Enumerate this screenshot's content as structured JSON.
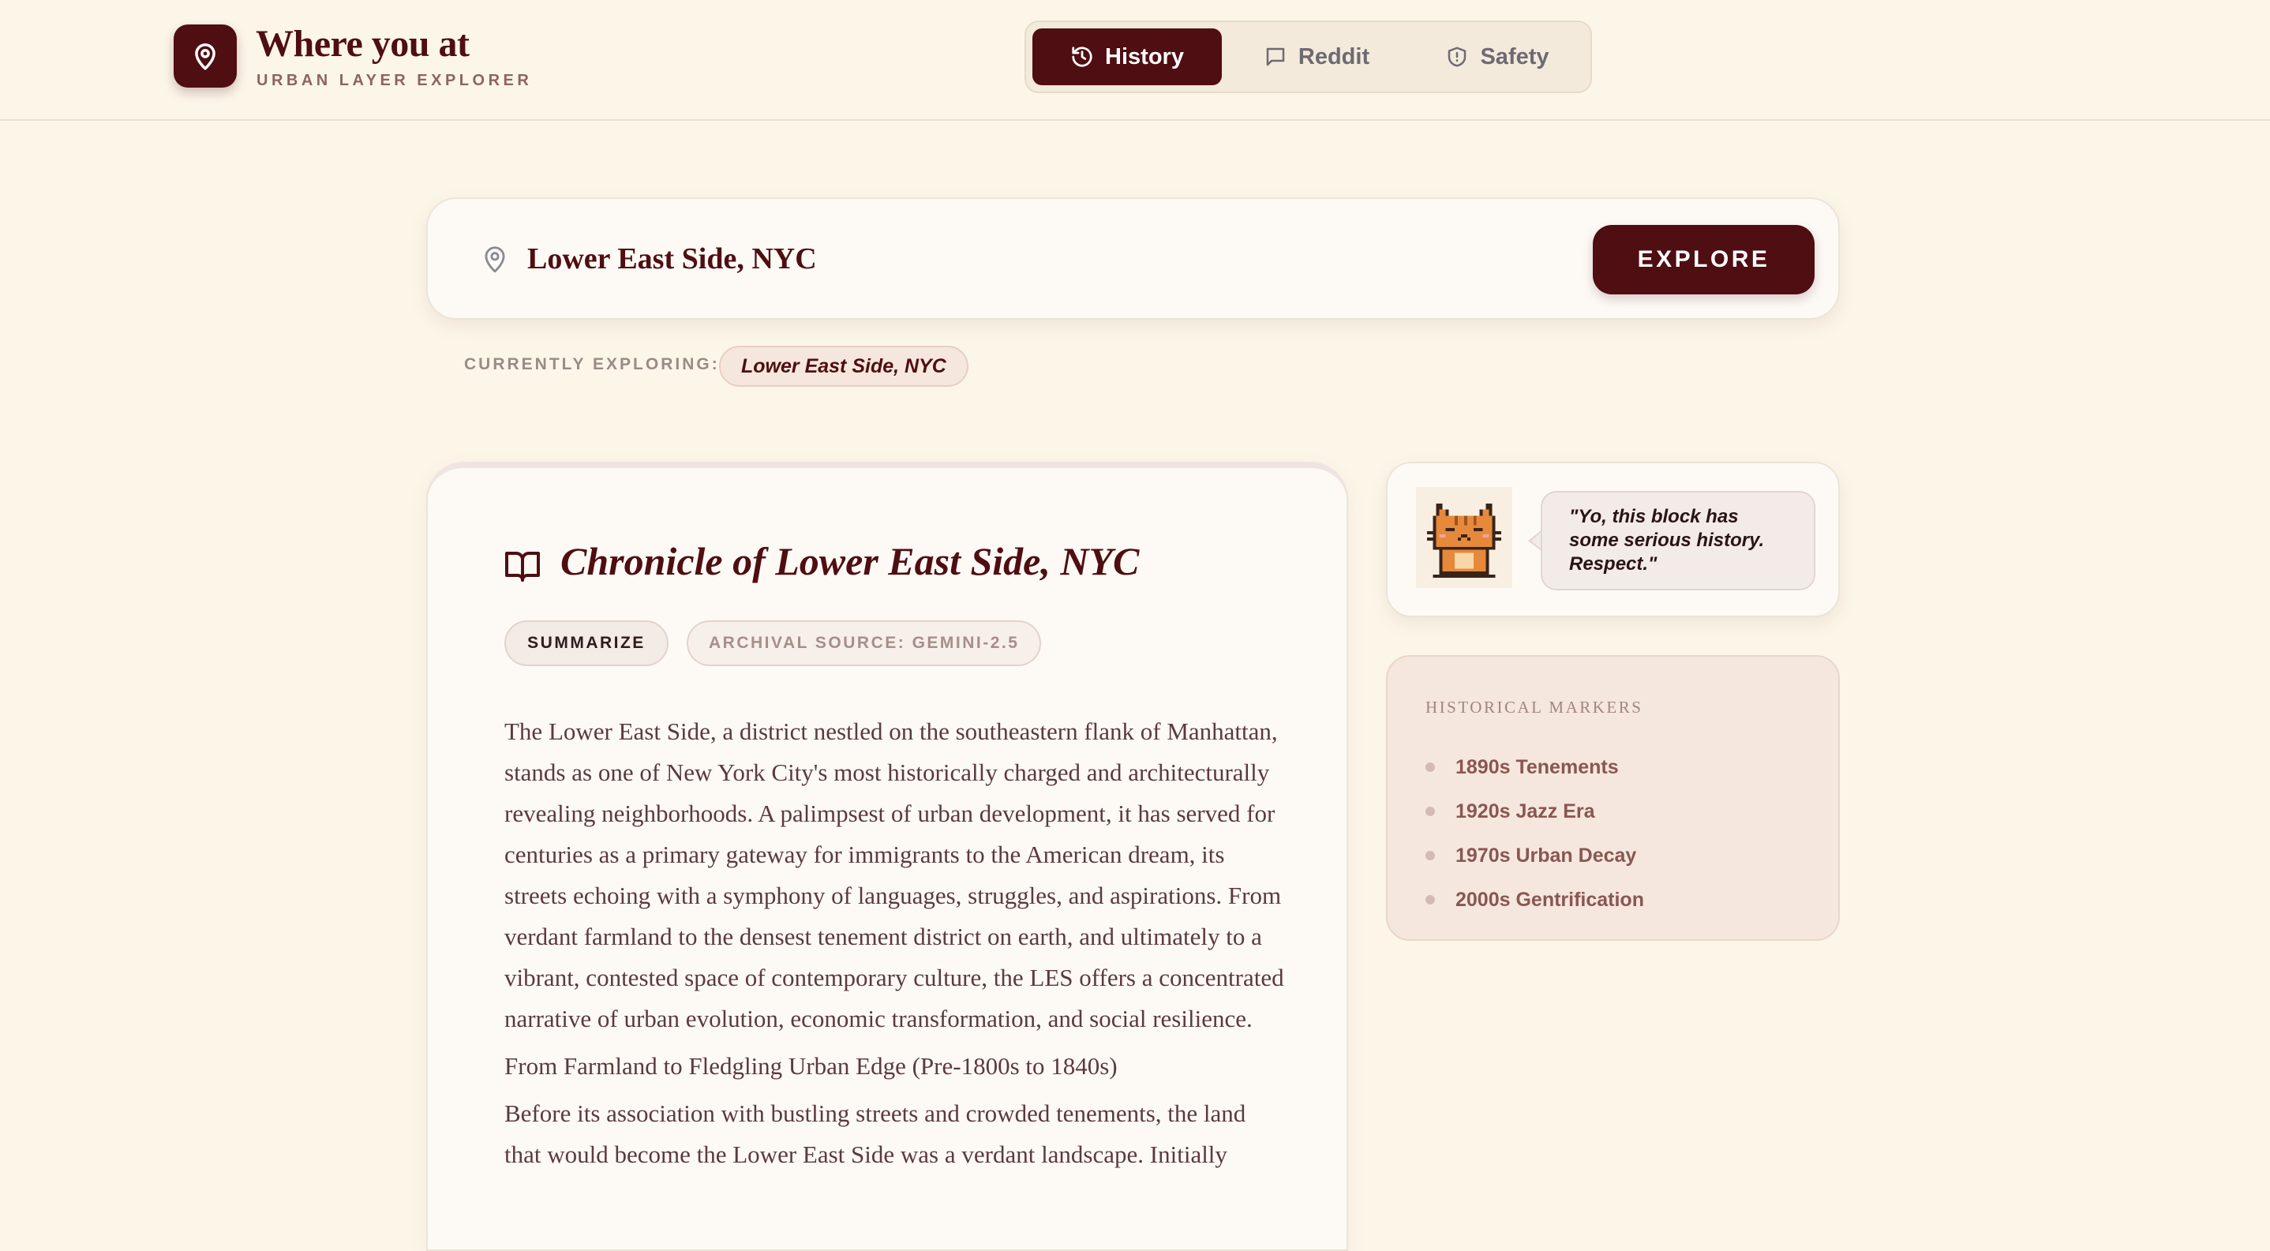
{
  "header": {
    "title": "Where you at",
    "subtitle": "URBAN LAYER EXPLORER"
  },
  "tabs": [
    {
      "label": "History",
      "icon": "history-icon",
      "active": true
    },
    {
      "label": "Reddit",
      "icon": "chat-bubble-icon",
      "active": false
    },
    {
      "label": "Safety",
      "icon": "shield-icon",
      "active": false
    }
  ],
  "search": {
    "value": "Lower East Side, NYC",
    "button_label": "EXPLORE"
  },
  "exploring": {
    "label": "CURRENTLY EXPLORING:",
    "value": "Lower East Side, NYC"
  },
  "chronicle": {
    "title": "Chronicle of Lower East Side, NYC",
    "summarize_label": "SUMMARIZE",
    "source_label": "ARCHIVAL SOURCE: GEMINI-2.5",
    "paragraphs": [
      "The Lower East Side, a district nestled on the southeastern flank of Manhattan, stands as one of New York City's most historically charged and architecturally revealing neighborhoods. A palimpsest of urban development, it has served for centuries as a primary gateway for immigrants to the American dream, its streets echoing with a symphony of languages, struggles, and aspirations. From verdant farmland to the densest tenement district on earth, and ultimately to a vibrant, contested space of contemporary culture, the LES offers a concentrated narrative of urban evolution, economic transformation, and social resilience.",
      "From Farmland to Fledgling Urban Edge (Pre-1800s to 1840s)",
      "Before its association with bustling streets and crowded tenements, the land that would become the Lower East Side was a verdant landscape. Initially"
    ]
  },
  "mascot": {
    "icon": "cat-mascot-icon",
    "quote": "\"Yo, this block has some serious history. Respect.\""
  },
  "markers": {
    "heading": "HISTORICAL MARKERS",
    "items": [
      "1890s Tenements",
      "1920s Jazz Era",
      "1970s Urban Decay",
      "2000s Gentrification"
    ]
  },
  "colors": {
    "background": "#fcf6e9",
    "accent": "#4f0e12",
    "card": "#fdfaf6",
    "marker_card": "#f5e7dd"
  }
}
